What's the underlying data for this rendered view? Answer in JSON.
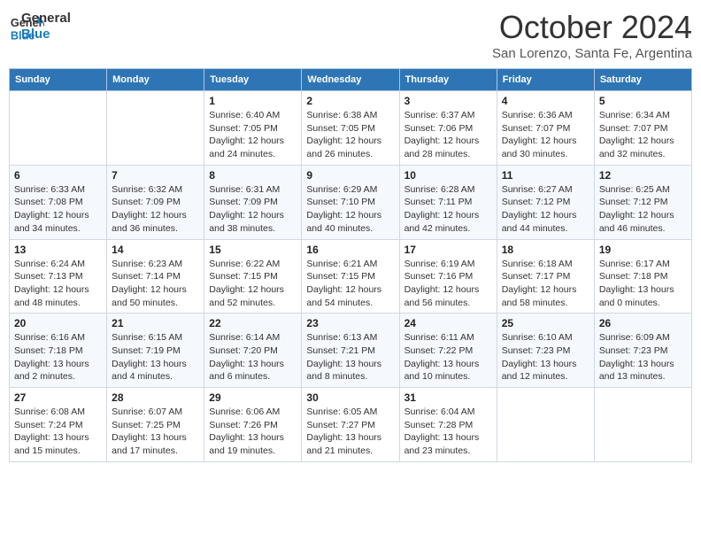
{
  "header": {
    "logo_general": "General",
    "logo_blue": "Blue",
    "month_title": "October 2024",
    "location": "San Lorenzo, Santa Fe, Argentina"
  },
  "days_of_week": [
    "Sunday",
    "Monday",
    "Tuesday",
    "Wednesday",
    "Thursday",
    "Friday",
    "Saturday"
  ],
  "weeks": [
    [
      {
        "day": "",
        "sunrise": "",
        "sunset": "",
        "daylight": ""
      },
      {
        "day": "",
        "sunrise": "",
        "sunset": "",
        "daylight": ""
      },
      {
        "day": "1",
        "sunrise": "Sunrise: 6:40 AM",
        "sunset": "Sunset: 7:05 PM",
        "daylight": "Daylight: 12 hours and 24 minutes."
      },
      {
        "day": "2",
        "sunrise": "Sunrise: 6:38 AM",
        "sunset": "Sunset: 7:05 PM",
        "daylight": "Daylight: 12 hours and 26 minutes."
      },
      {
        "day": "3",
        "sunrise": "Sunrise: 6:37 AM",
        "sunset": "Sunset: 7:06 PM",
        "daylight": "Daylight: 12 hours and 28 minutes."
      },
      {
        "day": "4",
        "sunrise": "Sunrise: 6:36 AM",
        "sunset": "Sunset: 7:07 PM",
        "daylight": "Daylight: 12 hours and 30 minutes."
      },
      {
        "day": "5",
        "sunrise": "Sunrise: 6:34 AM",
        "sunset": "Sunset: 7:07 PM",
        "daylight": "Daylight: 12 hours and 32 minutes."
      }
    ],
    [
      {
        "day": "6",
        "sunrise": "Sunrise: 6:33 AM",
        "sunset": "Sunset: 7:08 PM",
        "daylight": "Daylight: 12 hours and 34 minutes."
      },
      {
        "day": "7",
        "sunrise": "Sunrise: 6:32 AM",
        "sunset": "Sunset: 7:09 PM",
        "daylight": "Daylight: 12 hours and 36 minutes."
      },
      {
        "day": "8",
        "sunrise": "Sunrise: 6:31 AM",
        "sunset": "Sunset: 7:09 PM",
        "daylight": "Daylight: 12 hours and 38 minutes."
      },
      {
        "day": "9",
        "sunrise": "Sunrise: 6:29 AM",
        "sunset": "Sunset: 7:10 PM",
        "daylight": "Daylight: 12 hours and 40 minutes."
      },
      {
        "day": "10",
        "sunrise": "Sunrise: 6:28 AM",
        "sunset": "Sunset: 7:11 PM",
        "daylight": "Daylight: 12 hours and 42 minutes."
      },
      {
        "day": "11",
        "sunrise": "Sunrise: 6:27 AM",
        "sunset": "Sunset: 7:12 PM",
        "daylight": "Daylight: 12 hours and 44 minutes."
      },
      {
        "day": "12",
        "sunrise": "Sunrise: 6:25 AM",
        "sunset": "Sunset: 7:12 PM",
        "daylight": "Daylight: 12 hours and 46 minutes."
      }
    ],
    [
      {
        "day": "13",
        "sunrise": "Sunrise: 6:24 AM",
        "sunset": "Sunset: 7:13 PM",
        "daylight": "Daylight: 12 hours and 48 minutes."
      },
      {
        "day": "14",
        "sunrise": "Sunrise: 6:23 AM",
        "sunset": "Sunset: 7:14 PM",
        "daylight": "Daylight: 12 hours and 50 minutes."
      },
      {
        "day": "15",
        "sunrise": "Sunrise: 6:22 AM",
        "sunset": "Sunset: 7:15 PM",
        "daylight": "Daylight: 12 hours and 52 minutes."
      },
      {
        "day": "16",
        "sunrise": "Sunrise: 6:21 AM",
        "sunset": "Sunset: 7:15 PM",
        "daylight": "Daylight: 12 hours and 54 minutes."
      },
      {
        "day": "17",
        "sunrise": "Sunrise: 6:19 AM",
        "sunset": "Sunset: 7:16 PM",
        "daylight": "Daylight: 12 hours and 56 minutes."
      },
      {
        "day": "18",
        "sunrise": "Sunrise: 6:18 AM",
        "sunset": "Sunset: 7:17 PM",
        "daylight": "Daylight: 12 hours and 58 minutes."
      },
      {
        "day": "19",
        "sunrise": "Sunrise: 6:17 AM",
        "sunset": "Sunset: 7:18 PM",
        "daylight": "Daylight: 13 hours and 0 minutes."
      }
    ],
    [
      {
        "day": "20",
        "sunrise": "Sunrise: 6:16 AM",
        "sunset": "Sunset: 7:18 PM",
        "daylight": "Daylight: 13 hours and 2 minutes."
      },
      {
        "day": "21",
        "sunrise": "Sunrise: 6:15 AM",
        "sunset": "Sunset: 7:19 PM",
        "daylight": "Daylight: 13 hours and 4 minutes."
      },
      {
        "day": "22",
        "sunrise": "Sunrise: 6:14 AM",
        "sunset": "Sunset: 7:20 PM",
        "daylight": "Daylight: 13 hours and 6 minutes."
      },
      {
        "day": "23",
        "sunrise": "Sunrise: 6:13 AM",
        "sunset": "Sunset: 7:21 PM",
        "daylight": "Daylight: 13 hours and 8 minutes."
      },
      {
        "day": "24",
        "sunrise": "Sunrise: 6:11 AM",
        "sunset": "Sunset: 7:22 PM",
        "daylight": "Daylight: 13 hours and 10 minutes."
      },
      {
        "day": "25",
        "sunrise": "Sunrise: 6:10 AM",
        "sunset": "Sunset: 7:23 PM",
        "daylight": "Daylight: 13 hours and 12 minutes."
      },
      {
        "day": "26",
        "sunrise": "Sunrise: 6:09 AM",
        "sunset": "Sunset: 7:23 PM",
        "daylight": "Daylight: 13 hours and 13 minutes."
      }
    ],
    [
      {
        "day": "27",
        "sunrise": "Sunrise: 6:08 AM",
        "sunset": "Sunset: 7:24 PM",
        "daylight": "Daylight: 13 hours and 15 minutes."
      },
      {
        "day": "28",
        "sunrise": "Sunrise: 6:07 AM",
        "sunset": "Sunset: 7:25 PM",
        "daylight": "Daylight: 13 hours and 17 minutes."
      },
      {
        "day": "29",
        "sunrise": "Sunrise: 6:06 AM",
        "sunset": "Sunset: 7:26 PM",
        "daylight": "Daylight: 13 hours and 19 minutes."
      },
      {
        "day": "30",
        "sunrise": "Sunrise: 6:05 AM",
        "sunset": "Sunset: 7:27 PM",
        "daylight": "Daylight: 13 hours and 21 minutes."
      },
      {
        "day": "31",
        "sunrise": "Sunrise: 6:04 AM",
        "sunset": "Sunset: 7:28 PM",
        "daylight": "Daylight: 13 hours and 23 minutes."
      },
      {
        "day": "",
        "sunrise": "",
        "sunset": "",
        "daylight": ""
      },
      {
        "day": "",
        "sunrise": "",
        "sunset": "",
        "daylight": ""
      }
    ]
  ]
}
